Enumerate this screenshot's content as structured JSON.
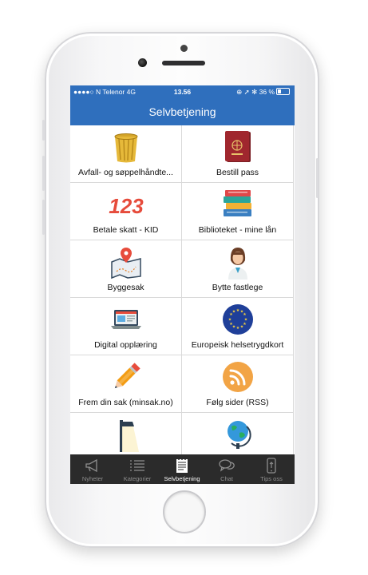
{
  "status": {
    "carrier": "●●●●○ N Telenor  4G",
    "time": "13.56",
    "right": "⊕ ➚ ✻ 36 %"
  },
  "header": {
    "title": "Selvbetjening"
  },
  "grid": [
    {
      "label": "Avfall- og søppelhåndte...",
      "icon": "trash-bin-icon"
    },
    {
      "label": "Bestill pass",
      "icon": "passport-icon"
    },
    {
      "label": "Betale skatt - KID",
      "icon": "numbers-123-icon"
    },
    {
      "label": "Biblioteket - mine lån",
      "icon": "books-icon"
    },
    {
      "label": "Byggesak",
      "icon": "map-pin-icon"
    },
    {
      "label": "Bytte fastlege",
      "icon": "doctor-icon"
    },
    {
      "label": "Digital opplæring",
      "icon": "laptop-icon"
    },
    {
      "label": "Europeisk helsetrygdkort",
      "icon": "eu-flag-icon"
    },
    {
      "label": "Frem din sak (minsak.no)",
      "icon": "pencil-icon"
    },
    {
      "label": "Følg sider (RSS)",
      "icon": "rss-icon"
    },
    {
      "label": "",
      "icon": "street-lamp-icon"
    },
    {
      "label": "",
      "icon": "globe-icon"
    }
  ],
  "tabs": [
    {
      "label": "Nyheter",
      "icon": "megaphone-icon",
      "active": false
    },
    {
      "label": "Kategorier",
      "icon": "list-icon",
      "active": false
    },
    {
      "label": "Selvbetjening",
      "icon": "notepad-icon",
      "active": true
    },
    {
      "label": "Chat",
      "icon": "chat-bubbles-icon",
      "active": false
    },
    {
      "label": "Tips oss",
      "icon": "phone-tip-icon",
      "active": false
    }
  ],
  "colors": {
    "brand": "#2f6fbd",
    "tabbar": "#2b2b2b"
  }
}
